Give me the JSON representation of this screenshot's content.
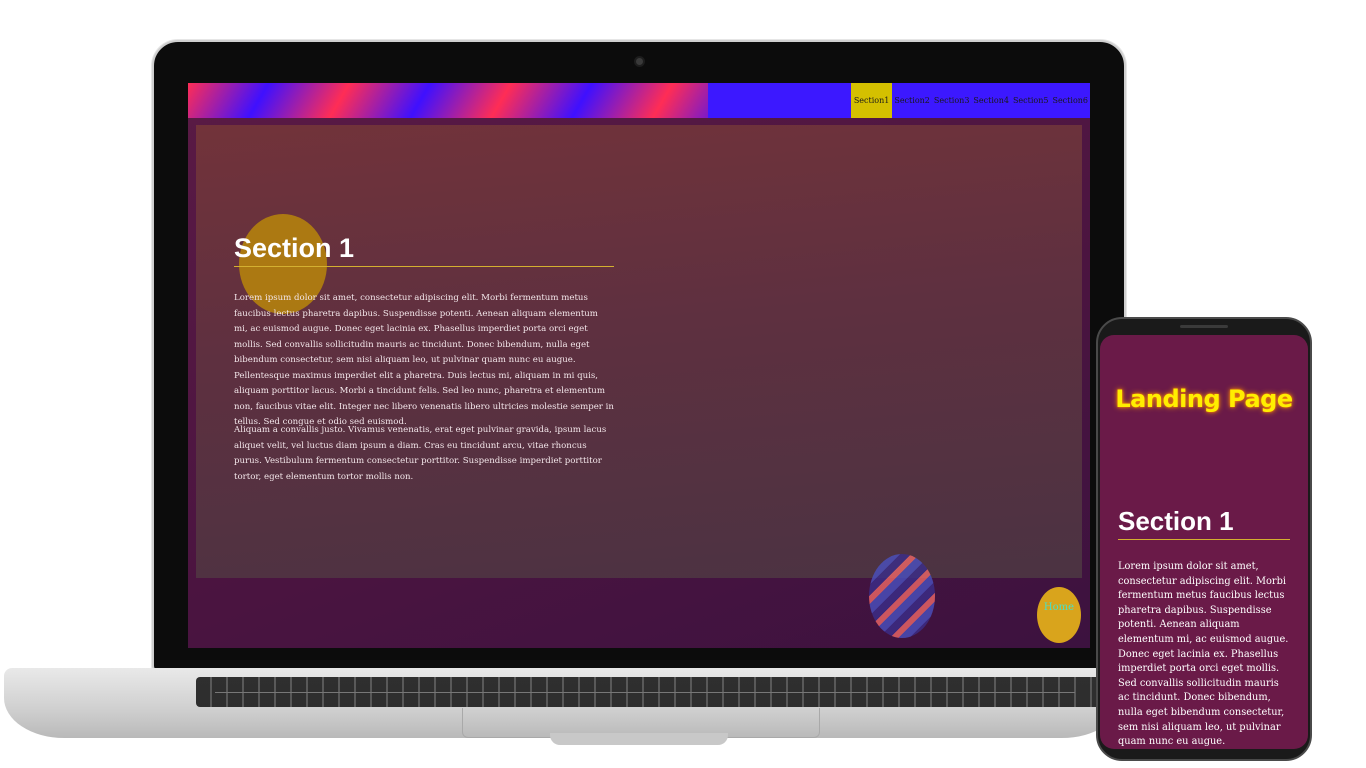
{
  "nav": {
    "items": [
      "Section1",
      "Section2",
      "Section3",
      "Section4",
      "Section5",
      "Section6"
    ],
    "active_index": 0
  },
  "section": {
    "title": "Section 1",
    "paragraph1": "Lorem ipsum dolor sit amet, consectetur adipiscing elit. Morbi fermentum metus faucibus lectus pharetra dapibus. Suspendisse potenti. Aenean aliquam elementum mi, ac euismod augue. Donec eget lacinia ex. Phasellus imperdiet porta orci eget mollis. Sed convallis sollicitudin mauris ac tincidunt. Donec bibendum, nulla eget bibendum consectetur, sem nisi aliquam leo, ut pulvinar quam nunc eu augue. Pellentesque maximus imperdiet elit a pharetra. Duis lectus mi, aliquam in mi quis, aliquam porttitor lacus. Morbi a tincidunt felis. Sed leo nunc, pharetra et elementum non, faucibus vitae elit. Integer nec libero venenatis libero ultricies molestie semper in tellus. Sed congue et odio sed euismod.",
    "paragraph2": "Aliquam a convallis justo. Vivamus venenatis, erat eget pulvinar gravida, ipsum lacus aliquet velit, vel luctus diam ipsum a diam. Cras eu tincidunt arcu, vitae rhoncus purus. Vestibulum fermentum consectetur porttitor. Suspendisse imperdiet porttitor tortor, eget elementum tortor mollis non."
  },
  "home_button": {
    "label": "Home"
  },
  "phone": {
    "page_title": "Landing Page",
    "section_title": "Section 1",
    "paragraph": "Lorem ipsum dolor sit amet, consectetur adipiscing elit. Morbi fermentum metus faucibus lectus pharetra dapibus. Suspendisse potenti. Aenean aliquam elementum mi, ac euismod augue. Donec eget lacinia ex. Phasellus imperdiet porta orci eget mollis. Sed convallis sollicitudin mauris ac tincidunt. Donec bibendum, nulla eget bibendum consectetur, sem nisi aliquam leo, ut pulvinar quam nunc eu augue. Pellentesque maximus"
  },
  "colors": {
    "nav_active": "#d4c000",
    "accent_title": "#ffee00",
    "home_button": "#d9a41c",
    "home_text": "#48e0c8"
  }
}
